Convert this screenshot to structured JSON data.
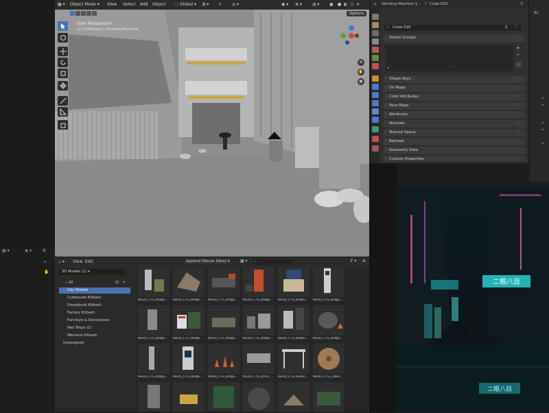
{
  "viewport": {
    "mode": "Object Mode",
    "menus": [
      "View",
      "Select",
      "Add",
      "Object"
    ],
    "transform": "Global",
    "options": "Options",
    "title": "User Perspective",
    "subtitle": "(1) Collection | Vending Machine"
  },
  "properties": {
    "object_name": "Vending Machine 1",
    "mesh_name": "Cube 010",
    "datablock_name": "Cube 010",
    "user_count": "2",
    "vertex_groups": "Vertex Groups",
    "panels": [
      "Shape Keys",
      "UV Maps",
      "Color Attributes",
      "Face Maps",
      "Attributes",
      "Normals",
      "Texture Space",
      "Remesh",
      "Geometry Data",
      "Custom Properties"
    ]
  },
  "asset_browser": {
    "menus": [
      "View",
      "Edit"
    ],
    "library": "3D Models (C)",
    "import_mode": "Append (Reuse Data)",
    "categories": [
      "All",
      "City Streets",
      "Cyberpunk Kitbash",
      "Dieselpunk Kitbash",
      "Factory Kitbash",
      "Furniture & Decorations",
      "Neo Tokyo (C)",
      "Warzone Kitbash",
      "Unassigned"
    ],
    "assets": [
      "KB3D_CTS_BldgS...",
      "KB3D_CTS_BldgS...",
      "KB3D_CTS_BldgS...",
      "KB3D_CTS_BldgS...",
      "KB3D_CTS_BldgS...",
      "KB3D_CTS_BldgS...",
      "KB3D_CTS_BldgS...",
      "KB3D_CTS_BldgS...",
      "KB3D_CTS_BldgS...",
      "KB3D_CTS_BldgS...",
      "KB3D_CTS_BldgS...",
      "KB3D_CTS_BldgS...",
      "KB3D_CTS_BldgS...",
      "KB3D_CTS_BldgS...",
      "KB3D_CTS_BldgS...",
      "KB3D_CTS_Brick_...",
      "KB3D_CTS_BusSt...",
      "KB3D_CTS_Cable..."
    ]
  },
  "reference": {
    "sign_text": "ニ眼八目",
    "sign_text_2": "ニ眼八目"
  },
  "outliner": {
    "label": "Sc"
  }
}
